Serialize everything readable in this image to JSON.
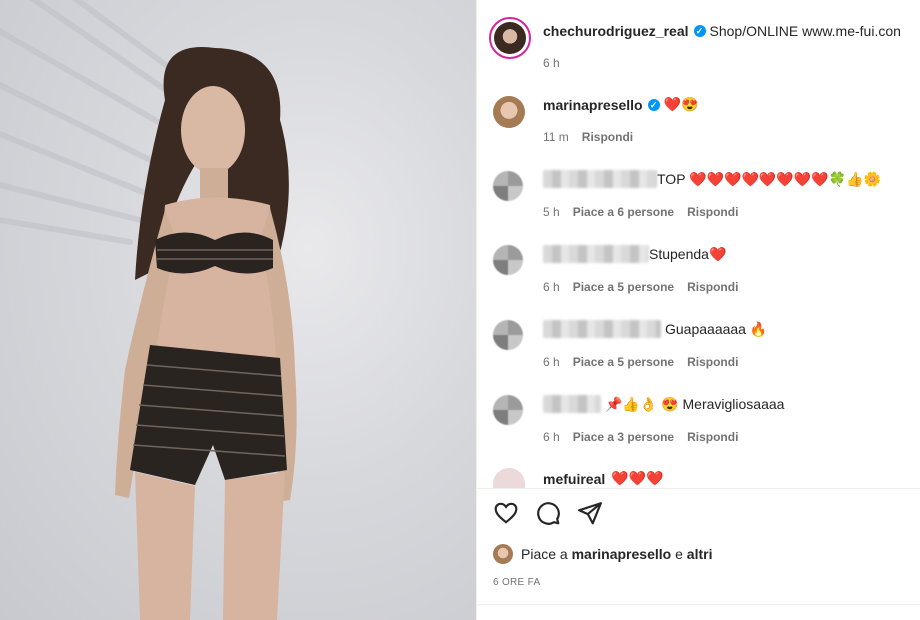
{
  "post": {
    "author": "chechurodriguez_real",
    "caption": "Shop/ONLINE www.me-fui.con",
    "time": "6 h"
  },
  "comments": [
    {
      "user": "marinapresello",
      "text": "❤️😍",
      "time": "11 m",
      "likes": "",
      "reply": "Rispondi",
      "blurred": false
    },
    {
      "user": "",
      "text": "TOP ❤️❤️❤️❤️❤️❤️❤️❤️🍀👍🌼",
      "time": "5 h",
      "likes": "Piace a 6 persone",
      "reply": "Rispondi",
      "blurred": true
    },
    {
      "user": "",
      "text": "Stupenda❤️",
      "time": "6 h",
      "likes": "Piace a 5 persone",
      "reply": "Rispondi",
      "blurred": true
    },
    {
      "user": "",
      "text": "Guapaaaaaa 🔥",
      "time": "6 h",
      "likes": "Piace a 5 persone",
      "reply": "Rispondi",
      "blurred": true
    },
    {
      "user": "",
      "text": "📌👍👌 😍 Meravigliosaaaa",
      "time": "6 h",
      "likes": "Piace a 3 persone",
      "reply": "Rispondi",
      "blurred": true
    },
    {
      "user": "mefuireal",
      "text": "❤️❤️❤️",
      "time": "",
      "likes": "",
      "reply": "",
      "blurred": false
    }
  ],
  "likes_line": {
    "prefix": "Piace a",
    "user": "marinapresello",
    "joiner": "e",
    "others": "altri"
  },
  "post_age": "6 ORE FA",
  "icons": [
    "heart-outline-icon",
    "comment-icon",
    "share-icon",
    "verified-badge-icon"
  ],
  "colors": {
    "verified": "#0095f6",
    "muted": "#737373",
    "heart": "#e0245e"
  }
}
